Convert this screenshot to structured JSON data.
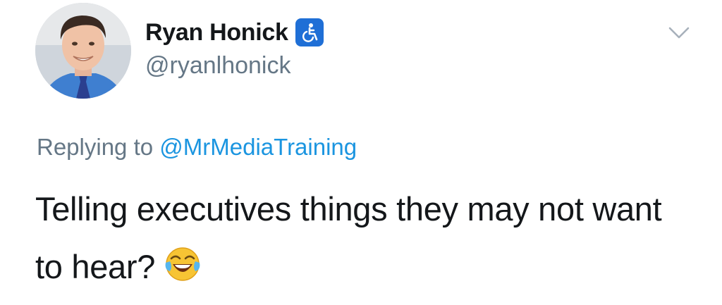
{
  "author": {
    "display_name": "Ryan Honick",
    "handle": "@ryanlhonick",
    "badge_icon": "wheelchair-accessibility-icon",
    "badge_color": "#1f6fd6"
  },
  "reply": {
    "prefix": "Replying to",
    "mention": "@MrMediaTraining",
    "mention_color": "#1b95e0"
  },
  "tweet": {
    "text": "Telling executives things they may not want to hear?",
    "emoji_icon": "face-with-tears-of-joy-icon"
  },
  "menu": {
    "icon": "chevron-down-icon"
  }
}
